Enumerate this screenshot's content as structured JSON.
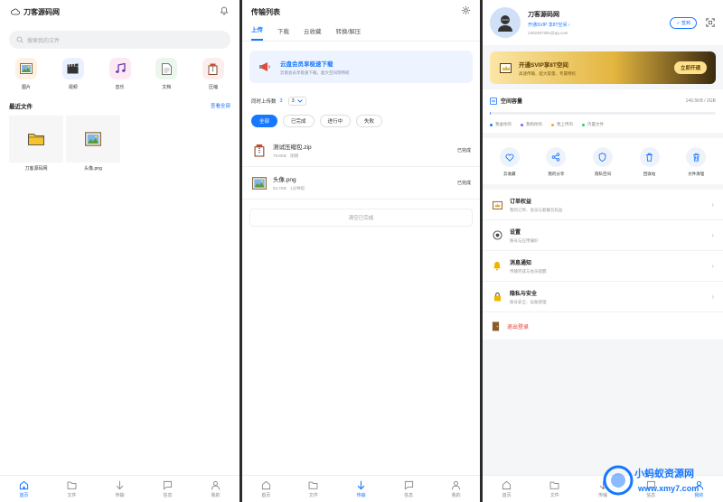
{
  "home": {
    "app_title": "刀客源码网",
    "search_placeholder": "搜索我的文件",
    "categories": [
      {
        "label": "图片",
        "icon": "image-icon",
        "bg": "#fdf1e3"
      },
      {
        "label": "视频",
        "icon": "clapper-icon",
        "bg": "#e9f0ff"
      },
      {
        "label": "音乐",
        "icon": "music-icon",
        "bg": "#fde9f3"
      },
      {
        "label": "文档",
        "icon": "document-icon",
        "bg": "#ebf7ec"
      },
      {
        "label": "压缩",
        "icon": "archive-icon",
        "bg": "#fdeeee"
      }
    ],
    "recent_title": "最近文件",
    "view_all": "查看全部",
    "recent_files": [
      {
        "name": "刀客源码网",
        "icon": "folder-icon"
      },
      {
        "name": "头像.png",
        "icon": "image-icon"
      }
    ]
  },
  "transfer": {
    "title": "传输列表",
    "tabs": [
      "上传",
      "下载",
      "云收藏",
      "转换/解压"
    ],
    "active_tab": 0,
    "banner_title": "云盘会员享极速下载",
    "banner_sub": "云盘会员享极速下载，超大空间等特权",
    "limit_label": "同时上传数",
    "limit_value": "3",
    "limit_select": "3",
    "filters": [
      "全部",
      "已完成",
      "进行中",
      "失败"
    ],
    "active_filter": 0,
    "items": [
      {
        "name": "测试压缩包.zip",
        "size": "79.8KB",
        "time": "刚刚",
        "status": "已完成",
        "icon": "archive-icon"
      },
      {
        "name": "头像.png",
        "size": "84.7KB",
        "time": "1分钟前",
        "status": "已完成",
        "icon": "image-icon"
      }
    ],
    "clear_label": "清空已完成"
  },
  "profile": {
    "name": "刀客源码网",
    "svip_text": "开通SVIP 享8T空间 ›",
    "email": "1302357281@qq.com",
    "checkin_label": "✓ 签到",
    "vip_title": "开通SVIP享8T空间",
    "vip_sub": "高速传输、超大容量、专属特权",
    "vip_button": "立即开通",
    "storage_title": "空间容量",
    "storage_value": "146.5KB / 2GB",
    "storage_fraction": 0.0001,
    "legend": [
      {
        "label": "我會你的",
        "color": "#1677ff"
      },
      {
        "label": "我和你的",
        "color": "#7c5cff"
      },
      {
        "label": "我上传的",
        "color": "#f5a623"
      },
      {
        "label": "内置文件",
        "color": "#34c759"
      }
    ],
    "tools": [
      {
        "label": "云收藏",
        "icon": "heart-icon"
      },
      {
        "label": "我的分享",
        "icon": "share-icon"
      },
      {
        "label": "隐私空间",
        "icon": "shield-icon"
      },
      {
        "label": "回收站",
        "icon": "trash-icon"
      },
      {
        "label": "文件清理",
        "icon": "broom-icon"
      }
    ],
    "menu": [
      {
        "title": "订单权益",
        "sub": "我的订单、会员与套餐包权益",
        "icon": "order-icon"
      },
      {
        "title": "设置",
        "sub": "账号与应用偏好",
        "icon": "settings-icon"
      },
      {
        "title": "消息通知",
        "sub": "传输完成与会员提醒",
        "icon": "bell-icon"
      },
      {
        "title": "隐私与安全",
        "sub": "账号安全、设备管理",
        "icon": "lock-icon"
      }
    ],
    "logout": "退出登录"
  },
  "nav": [
    "首页",
    "文件",
    "传输",
    "信息",
    "我的"
  ],
  "watermark": {
    "title": "小蚂蚁资源网",
    "url": "www.xmy7.com"
  },
  "colors": {
    "accent": "#1677ff",
    "danger": "#e53935",
    "gold": "#e3b53f"
  }
}
